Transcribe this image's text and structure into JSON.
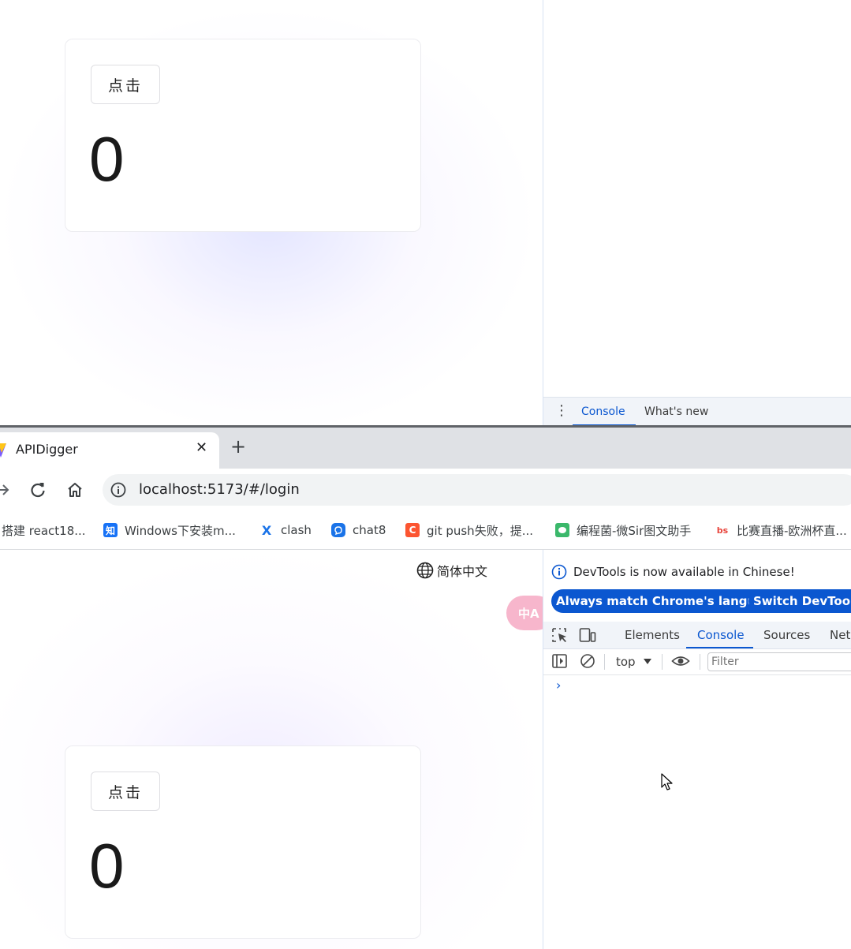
{
  "top_frame": {
    "card": {
      "button_label": "点击",
      "count": "0"
    },
    "drawer": {
      "tabs": [
        "Console",
        "What's new"
      ],
      "active_tab": "Console"
    }
  },
  "browser": {
    "tab": {
      "title": "APIDigger",
      "close_glyph": "✕",
      "new_tab_glyph": "+"
    },
    "omnibox": {
      "url": "localhost:5173/#/login"
    },
    "bookmarks": [
      {
        "label": "搭建 react18...",
        "icon": "none"
      },
      {
        "label": "Windows下安装m...",
        "icon": "zhihu-icon",
        "glyph": "知",
        "color": "#1772f6"
      },
      {
        "label": "clash",
        "icon": "clash-x-icon",
        "glyph": "X",
        "color": "#1a73e8"
      },
      {
        "label": "chat8",
        "icon": "chat-bubble-icon",
        "color": "#1a73e8"
      },
      {
        "label": "git push失败，提...",
        "icon": "csdn-c-icon",
        "glyph": "C",
        "color": "#fc5531"
      },
      {
        "label": "编程菌-微Sir图文助手",
        "icon": "wechat-icon",
        "color": "#3bb86b"
      },
      {
        "label": "比赛直播-欧洲杯直...",
        "icon": "bs-icon",
        "glyph": "bs",
        "color": "#e8453c"
      }
    ]
  },
  "page": {
    "lang_switch_label": "简体中文",
    "translate_glyph": "中A",
    "card": {
      "button_label": "点击",
      "count": "0"
    }
  },
  "devtools": {
    "info_message": "DevTools is now available in Chinese!",
    "pill_match": "Always match Chrome's language",
    "pill_switch": "Switch DevTools to",
    "tabs": [
      "Elements",
      "Console",
      "Sources",
      "Network"
    ],
    "active_tab": "Console",
    "context_select": "top",
    "filter_placeholder": "Filter",
    "prompt_glyph": "›"
  },
  "colors": {
    "accent": "#0b57d0",
    "tab_strip": "#dfe1e5",
    "omnibox": "#f1f3f4",
    "translate_fab": "#f7b6cc"
  }
}
